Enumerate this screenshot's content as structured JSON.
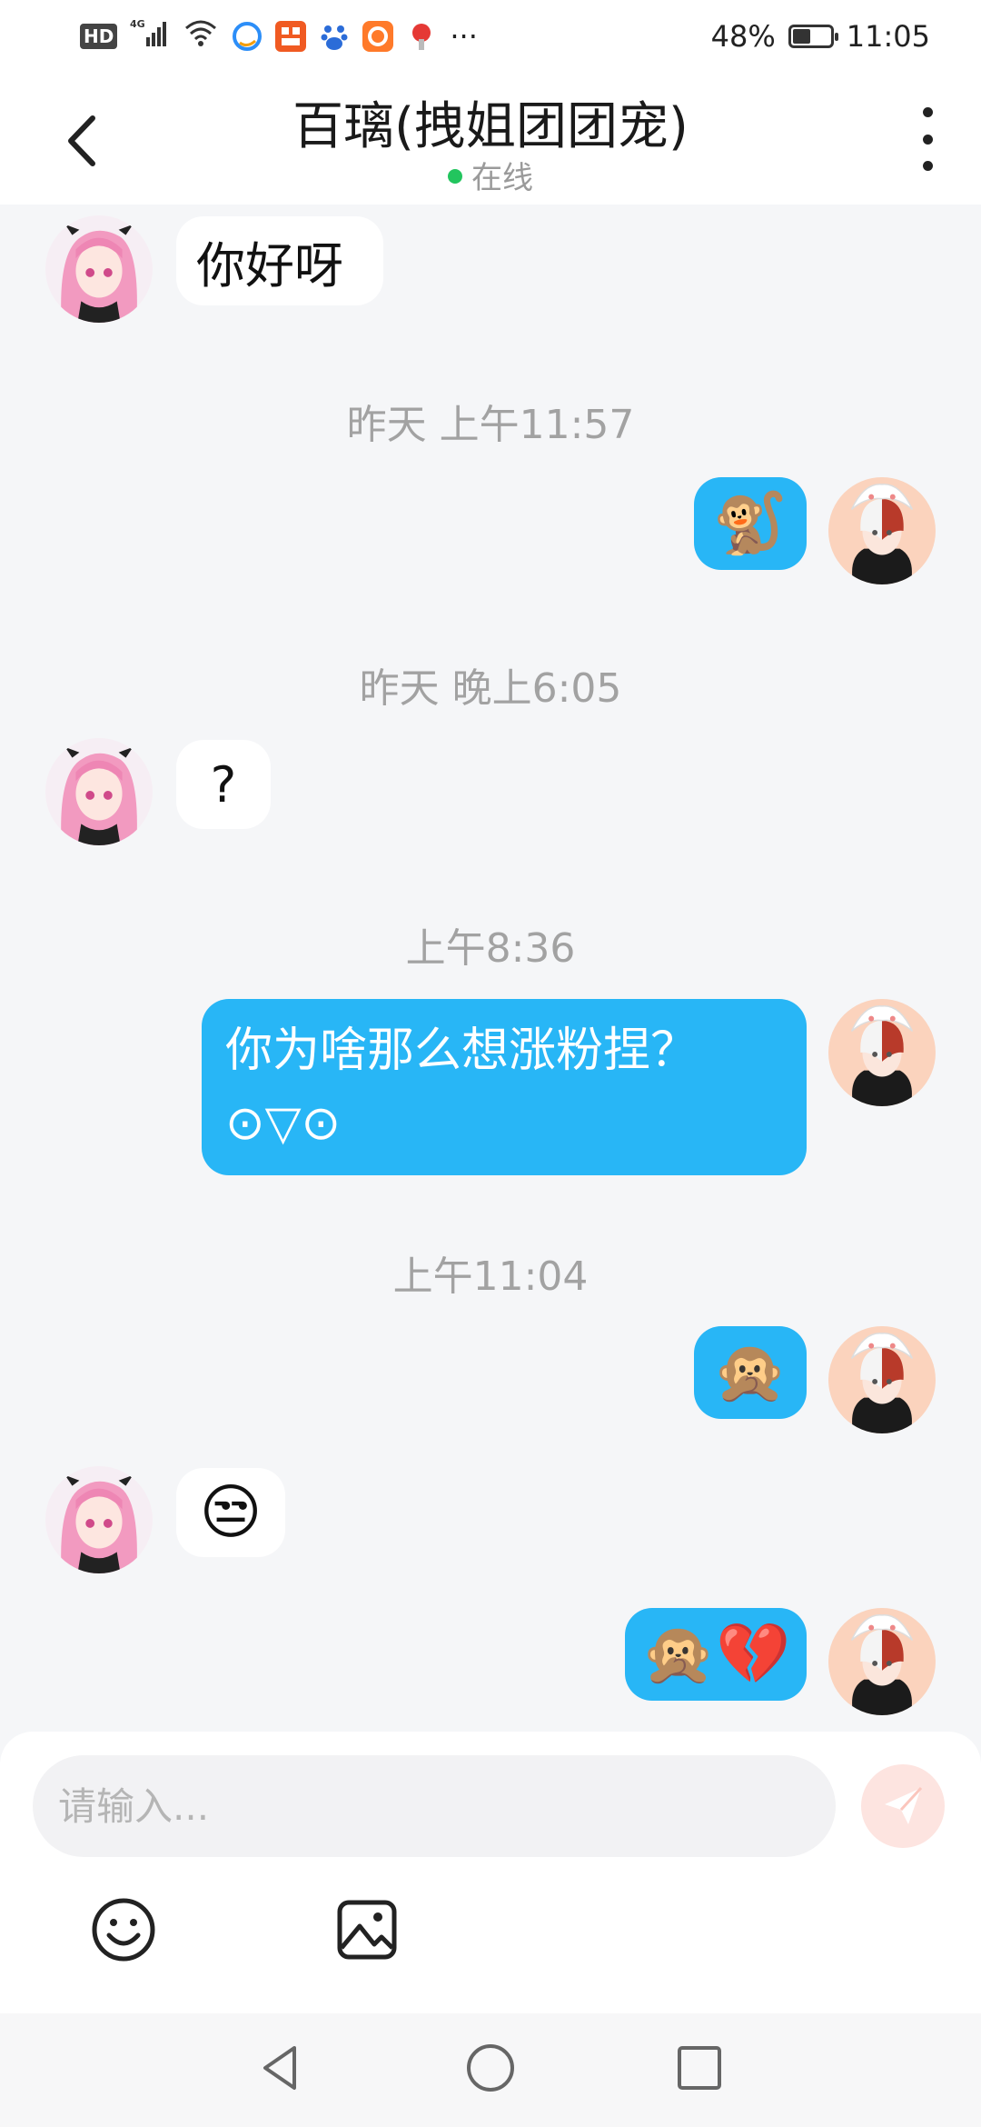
{
  "status_bar": {
    "network_hd": "HD",
    "network_type": "4G",
    "more_indicator": "···",
    "battery_percent": "48%",
    "battery_level": 0.48,
    "time": "11:05"
  },
  "header": {
    "title": "百璃(拽姐团团宠)",
    "presence": "在线",
    "presence_color": "#22c55e"
  },
  "chat": {
    "messages": [
      {
        "side": "in",
        "text": "你好呀"
      },
      {
        "type": "timestamp",
        "text": "昨天 上午11:57"
      },
      {
        "side": "out",
        "text": "🐒"
      },
      {
        "type": "timestamp",
        "text": "昨天 晚上6:05"
      },
      {
        "side": "in",
        "text": "?"
      },
      {
        "type": "timestamp",
        "text": "上午8:36"
      },
      {
        "side": "out",
        "text_line1": "你为啥那么想涨粉捏？",
        "text_line2": "⊙▽⊙"
      },
      {
        "type": "timestamp",
        "text": "上午11:04"
      },
      {
        "side": "out",
        "text": "🙊"
      },
      {
        "side": "in",
        "text": "😒"
      },
      {
        "side": "out",
        "text": "🙊💔"
      }
    ]
  },
  "input": {
    "placeholder": "请输入..."
  },
  "colors": {
    "outgoing_bubble": "#28b6f6",
    "incoming_bubble": "#ffffff",
    "background": "#f5f6f8"
  },
  "icons": {
    "back": "chevron-left-icon",
    "more": "more-vertical-icon",
    "send": "send-icon",
    "emoji": "smiley-icon",
    "image": "image-icon"
  }
}
